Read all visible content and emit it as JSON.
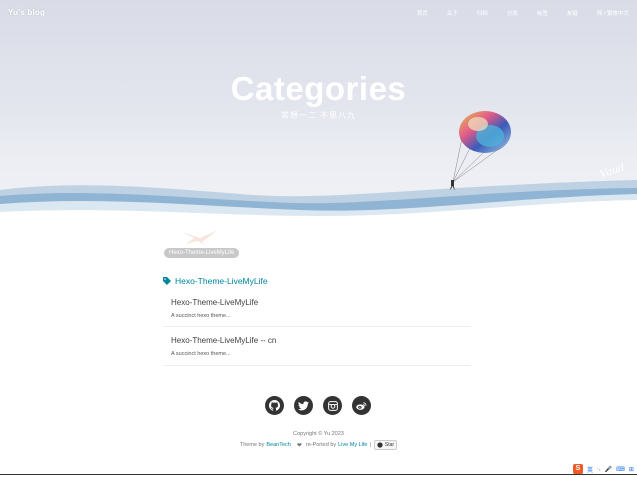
{
  "nav": {
    "brand": "Yu's blog",
    "links": [
      "首页",
      "关于",
      "归档",
      "分类",
      "标签",
      "友链",
      "简 / 繁体中文"
    ]
  },
  "hero": {
    "title": "Categories",
    "subtitle": "常想一二 不思八九",
    "signature": "Vaud"
  },
  "tag_cloud": {
    "tag": "Hexo-Theme-LiveMyLife"
  },
  "category": {
    "name": "Hexo-Theme-LiveMyLife",
    "posts": [
      {
        "title": "Hexo-Theme-LiveMyLife",
        "excerpt": "A succinct hexo theme..."
      },
      {
        "title": "Hexo-Theme-LiveMyLife -- cn",
        "excerpt": "A succinct hexo theme..."
      }
    ]
  },
  "footer": {
    "social": [
      "github-icon",
      "twitter-icon",
      "instagram-icon",
      "weibo-icon"
    ],
    "copyright": "Copyright © Yu 2023",
    "theme_by": "Theme by",
    "beantech": "BeanTech",
    "reported_by": "re-Ported by",
    "livemylife": "Live My Life",
    "separator": "|",
    "star": "Star"
  },
  "ime": {
    "label1": "英",
    "label2": "·,",
    "label3": "🎤",
    "label4": "⌨",
    "label5": "⊞"
  },
  "colors": {
    "accent": "#0085a1",
    "hero_top": "#d9dce7",
    "wave": "#8fb6d4"
  }
}
